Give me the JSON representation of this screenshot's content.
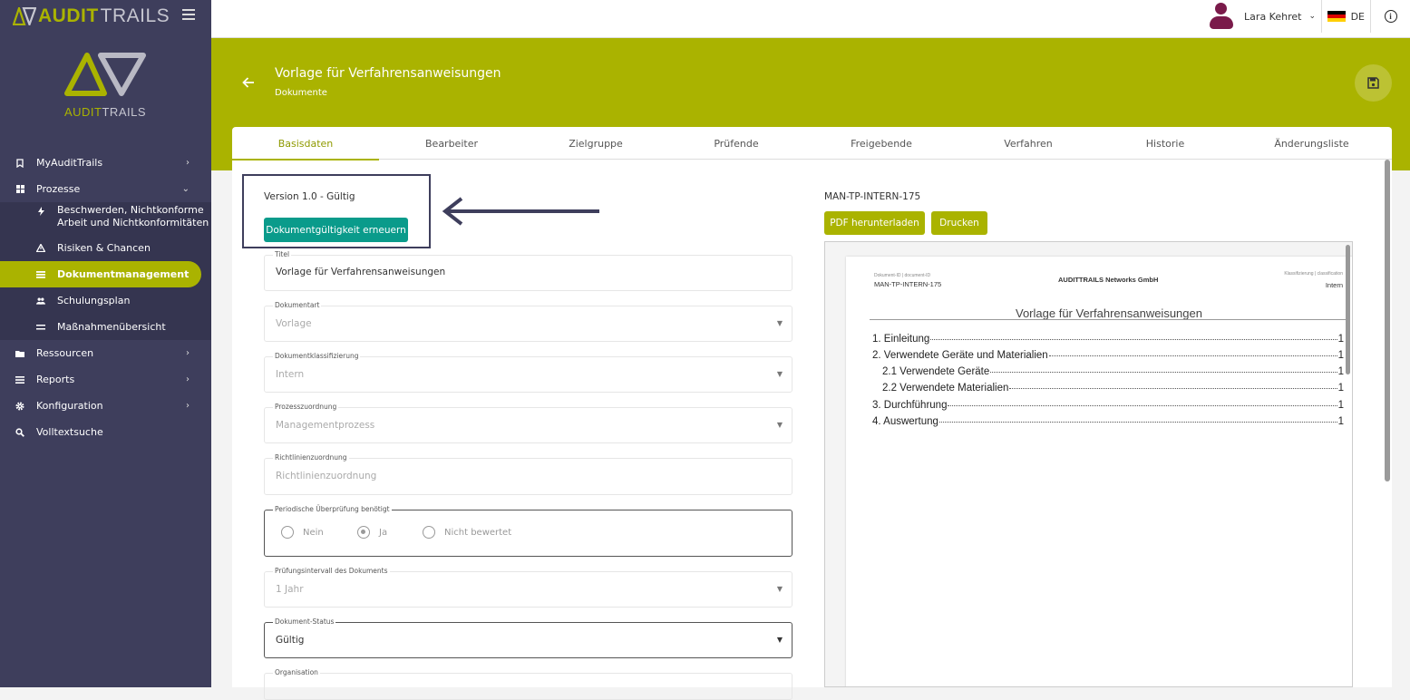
{
  "brand": {
    "part1": "AUDIT",
    "part2": "TRAILS"
  },
  "logo": {
    "part1": "AUDIT",
    "part2": "TRAILS"
  },
  "nav": {
    "myaudittrails": "MyAuditTrails",
    "prozesse": "Prozesse",
    "sub": {
      "beschwerden_l1": "Beschwerden, Nichtkonforme",
      "beschwerden_l2": "Arbeit und Nichtkonformitäten",
      "risiken": "Risiken & Chancen",
      "dokumentmanagement": "Dokumentmanagement",
      "schulungsplan": "Schulungsplan",
      "massnahmen": "Maßnahmenübersicht"
    },
    "ressourcen": "Ressourcen",
    "reports": "Reports",
    "konfiguration": "Konfiguration",
    "volltextsuche": "Volltextsuche"
  },
  "topbar": {
    "user_name": "Lara Kehret",
    "lang": "DE",
    "info": "i"
  },
  "header": {
    "title": "Vorlage für Verfahrensanweisungen",
    "subtitle": "Dokumente"
  },
  "tabs": [
    "Basisdaten",
    "Bearbeiter",
    "Zielgruppe",
    "Prüfende",
    "Freigebende",
    "Verfahren",
    "Historie",
    "Änderungsliste"
  ],
  "form": {
    "version": "Version 1.0 - Gültig",
    "renew_button": "Dokumentgültigkeit erneuern",
    "titel_label": "Titel",
    "titel_value": "Vorlage für Verfahrensanweisungen",
    "dokumentart_label": "Dokumentart",
    "dokumentart_value": "Vorlage",
    "klassifizierung_label": "Dokumentklassifizierung",
    "klassifizierung_value": "Intern",
    "prozess_label": "Prozesszuordnung",
    "prozess_value": "Managementprozess",
    "richtlinien_label": "Richtlinienzuordnung",
    "richtlinien_placeholder": "Richtlinienzuordnung",
    "periodisch_label": "Periodische Überprüfung benötigt",
    "radio_nein": "Nein",
    "radio_ja": "Ja",
    "radio_nicht": "Nicht bewertet",
    "intervall_label": "Prüfungsintervall des Dokuments",
    "intervall_value": "1 Jahr",
    "status_label": "Dokument-Status",
    "status_value": "Gültig",
    "organisation_label": "Organisation"
  },
  "preview": {
    "doc_id": "MAN-TP-INTERN-175",
    "pdf_button": "PDF herunterladen",
    "print_button": "Drucken",
    "hdr_id_label": "Dokument-ID | document-ID",
    "hdr_id_value": "MAN-TP-INTERN-175",
    "hdr_company": "AUDITTRAILS Networks GmbH",
    "hdr_class_label": "Klassifizierung | classification",
    "hdr_class_value": "Intern",
    "title": "Vorlage für Verfahrensanweisungen",
    "toc": [
      {
        "text": "1. Einleitung",
        "page": "1"
      },
      {
        "text": "2. Verwendete Geräte und Materialien",
        "page": "1"
      },
      {
        "text": "2.1 Verwendete Geräte",
        "page": "1"
      },
      {
        "text": "2.2 Verwendete Materialien",
        "page": "1"
      },
      {
        "text": "3. Durchführung",
        "page": "1"
      },
      {
        "text": "4. Auswertung",
        "page": "1"
      }
    ]
  },
  "colors": {
    "accent": "#aab300",
    "sidebar": "#3e3e5c",
    "teal": "#0a9b8b"
  }
}
